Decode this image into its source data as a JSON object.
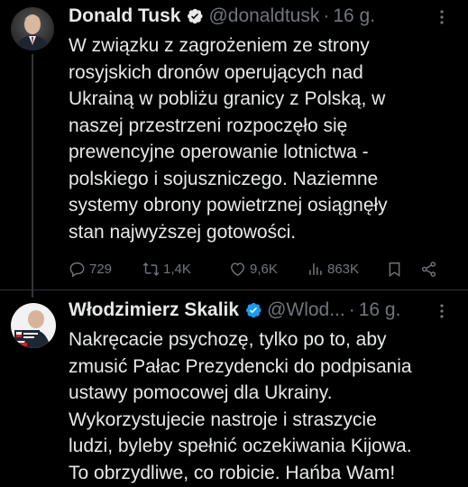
{
  "tweets": [
    {
      "display_name": "Donald Tusk",
      "handle": "@donaldtusk",
      "separator": "·",
      "time": "16 g.",
      "text": "W związku z zagrożeniem ze strony\nrosyjskich dronów operujących nad\nUkrainą w pobliżu granicy z Polską, w\nnaszej przestrzeni rozpoczęło się\nprewencyjne operowanie lotnictwa -\npolskiego i sojuszniczego. Naziemne\nsystemy obrony powietrznej osiągnęły\nstan najwyższej gotowości.",
      "stats": {
        "replies": "729",
        "reposts": "1,4K",
        "likes": "9,6K",
        "views": "863K"
      },
      "icons": {
        "verified": "verified-badge-icon",
        "more": "more-icon",
        "reply": "reply-icon",
        "repost": "repost-icon",
        "like": "heart-icon",
        "views": "views-icon",
        "bookmark": "bookmark-icon",
        "share": "share-icon"
      }
    },
    {
      "display_name": "Włodzimierz Skalik",
      "handle": "@Wlod...",
      "separator": "·",
      "time": "16 g.",
      "text": "Nakręcacie psychozę, tylko po to, aby\nzmusić Pałac Prezydencki do podpisania\nustawy pomocowej dla Ukrainy.\nWykorzystujecie nastroje i straszycie\nludzi, byleby spełnić oczekiwania Kijowa.\nTo obrzydliwe, co robicie. Hańba Wam!",
      "icons": {
        "verified": "verified-badge-icon",
        "more": "more-icon"
      }
    }
  ],
  "colors": {
    "background": "#000000",
    "text": "#e7e9ea",
    "muted": "#71767b",
    "verified": "#1d9bf0",
    "divider": "#2f3336"
  }
}
